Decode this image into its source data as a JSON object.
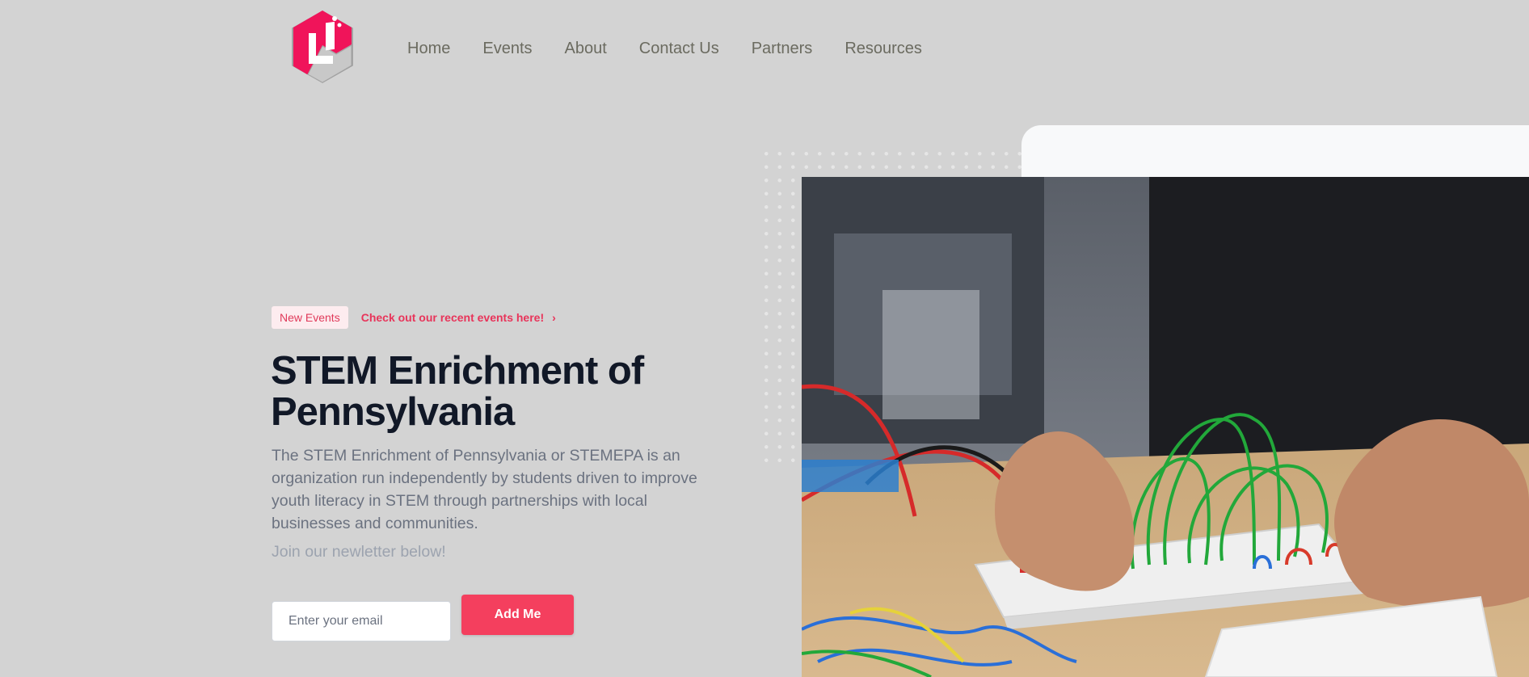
{
  "nav": {
    "items": [
      "Home",
      "Events",
      "About",
      "Contact Us",
      "Partners",
      "Resources"
    ]
  },
  "hero": {
    "badge": "New Events",
    "badge_link": "Check out our recent events here!",
    "title": "STEM Enrichment of Pennsylvania",
    "description": "The STEM Enrichment of Pennsylvania or STEMEPA is an organization run independently by students driven to improve youth literacy in STEM through partnerships with local businesses and communities.",
    "newsletter_prompt": "Join our newletter below!",
    "email_placeholder": "Enter your email",
    "submit_label": "Add Me"
  },
  "colors": {
    "background": "#d3d3d3",
    "accent": "#f43f5e",
    "logo": "#f0145a"
  },
  "icons": {
    "logo": "hexagon-flask-logo",
    "badge_chevron": "chevron-right-icon"
  }
}
